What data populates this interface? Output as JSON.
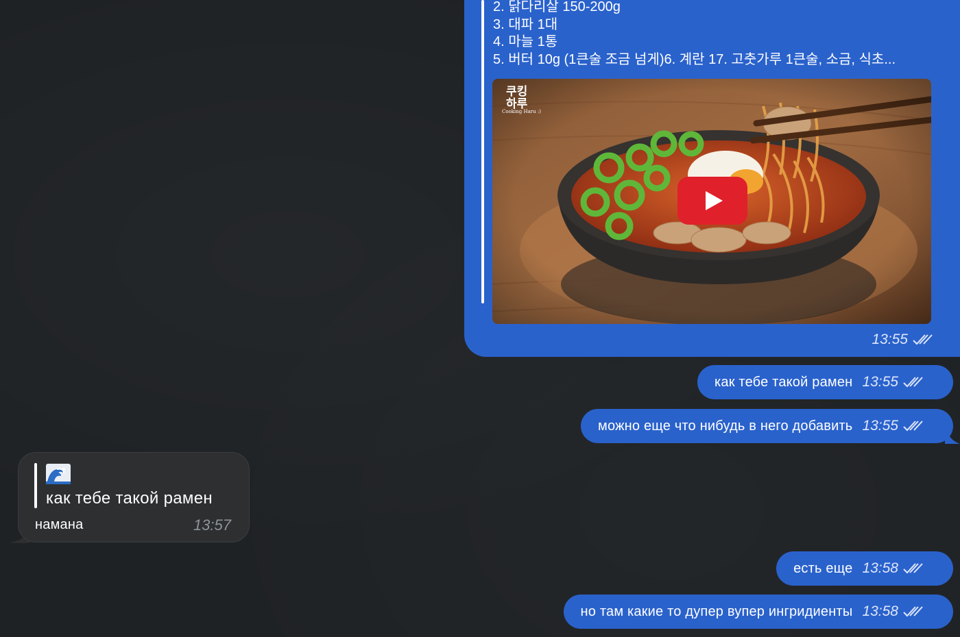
{
  "preview": {
    "lines": [
      "2. 닭다리살 150-200g",
      "3. 대파 1대",
      "4. 마늘 1통",
      "5. 버터 10g (1큰술 조금 넘게)6. 계란 17. 고춧가루 1큰술, 소금, 식초..."
    ],
    "channel_logo_line1": "쿠킹",
    "channel_logo_line2": "하루",
    "channel_logo_sub": "Cooking Haru :)",
    "time": "13:55"
  },
  "messages_out": [
    {
      "text": "как тебе такой рамен",
      "time": "13:55"
    },
    {
      "text": "можно еще что нибудь в него добавить",
      "time": "13:55"
    },
    {
      "text": "есть еще",
      "time": "13:58"
    },
    {
      "text": "но там какие то дупер вупер ингридиенты",
      "time": "13:58"
    }
  ],
  "message_in": {
    "quote_emoji": "🌊",
    "quote_text": "как тебе такой рамен",
    "sender": "намана",
    "time": "13:57"
  },
  "colors": {
    "bubble_out": "#2a62cc",
    "bubble_in": "#2d2f31",
    "background": "#1f2225",
    "play_button": "#e0202a"
  },
  "icons": {
    "read_receipt": "double-check-icon",
    "play": "play-icon",
    "wave": "wave-emoji"
  }
}
